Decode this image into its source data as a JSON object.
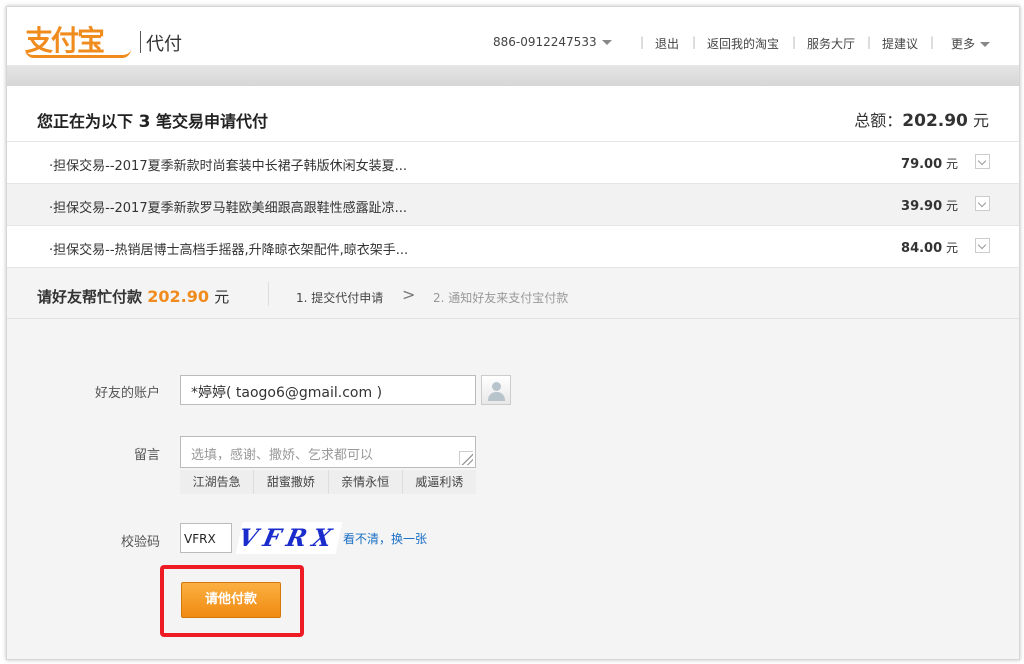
{
  "header": {
    "logo_text": "支付宝",
    "logo_sub": "代付",
    "account": "886-0912247533",
    "nav": [
      "退出",
      "返回我的淘宝",
      "服务大厅",
      "提建议",
      "更多"
    ],
    "separator": "|"
  },
  "summary": {
    "title_prefix": "您正在为以下",
    "count": "3",
    "title_suffix": "笔交易申请代付",
    "total_label": "总额：",
    "total_amount": "202.90",
    "currency": "元"
  },
  "items": [
    {
      "name": "·担保交易--2017夏季新款时尚套装中长裙子韩版休闲女装夏...",
      "price": "79.00",
      "unit": "元"
    },
    {
      "name": "·担保交易--2017夏季新款罗马鞋欧美细跟高跟鞋性感露趾凉...",
      "price": "39.90",
      "unit": "元"
    },
    {
      "name": "·担保交易--热销居博士高档手摇器,升降晾衣架配件,晾衣架手...",
      "price": "84.00",
      "unit": "元"
    }
  ],
  "pay": {
    "label": "请好友帮忙付款",
    "amount": "202.90",
    "unit": "元",
    "step1": "1. 提交代付申请",
    "arrow": ">",
    "step2": "2. 通知好友来支付宝付款"
  },
  "form": {
    "account_label": "好友的账户",
    "account_value": "*婷婷( taogo6@gmail.com )",
    "message_label": "留言",
    "message_placeholder": "选填，感谢、撒娇、乞求都可以",
    "presets": [
      "江湖告急",
      "甜蜜撒娇",
      "亲情永恒",
      "威逼利诱"
    ],
    "captcha_label": "校验码",
    "captcha_value": "VFRX",
    "captcha_image_text": "VFRX",
    "refresh_link": "看不清，换一张",
    "submit_label": "请他付款"
  },
  "colors": {
    "accent_orange": "#f08c1e",
    "link_blue": "#1a6fc4",
    "highlight_red": "#ee1b24",
    "captcha_blue": "#1a2dcc"
  }
}
